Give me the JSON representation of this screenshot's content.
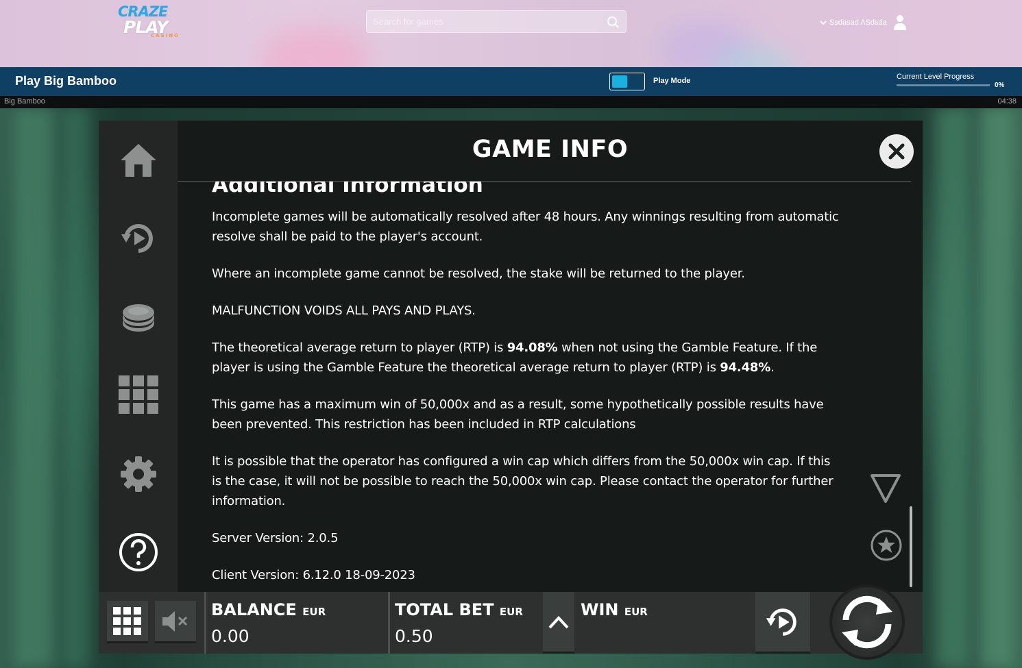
{
  "site": {
    "logo": {
      "line1": "CRAZE",
      "line2": "PLAY",
      "line3": "CASINO"
    },
    "search": {
      "placeholder": "Search for games"
    },
    "user": {
      "name": "Ssdasad ASdsda"
    }
  },
  "title_bar": {
    "title": "Play Big Bamboo",
    "play_mode_label": "Play Mode",
    "level_progress_label": "Current Level Progress",
    "level_progress_value": "0%",
    "level_progress_fraction": 0.0
  },
  "game_strip": {
    "game_name": "Big Bamboo",
    "clock": "04:38"
  },
  "dialog": {
    "title": "GAME INFO",
    "section_heading": "Additional Information",
    "paragraphs": {
      "p1": "Incomplete games will be automatically resolved after 48 hours. Any winnings resulting from automatic resolve shall be paid to the player's account.",
      "p2": "Where an incomplete game cannot be resolved, the stake will be returned to the player.",
      "p3": "MALFUNCTION VOIDS ALL PAYS AND PLAYS.",
      "p4a": "The theoretical average return to player (RTP) is ",
      "p4b": "94.08%",
      "p4c": " when not using the Gamble Feature. If the player is using the Gamble Feature the theoretical average return to player (RTP) is ",
      "p4d": "94.48%",
      "p4e": ".",
      "p5": "This game has a maximum win of 50,000x and as a result, some hypothetically possible results have been prevented. This restriction has been included in RTP calculations",
      "p6": "It is possible that the operator has configured a win cap which differs from the 50,000x win cap. If this is the case, it will not be possible to reach the 50,000x win cap. Please contact the operator for further information.",
      "p7": "Server Version: 2.0.5",
      "p8": "Client Version: 6.12.0 18-09-2023"
    },
    "side_menu_icons": [
      "home-icon",
      "autoplay-icon",
      "coins-icon",
      "grid-icon",
      "gear-icon",
      "help-icon"
    ]
  },
  "control_bar": {
    "balance_label": "BALANCE",
    "balance_currency": "EUR",
    "balance_value": "0.00",
    "total_bet_label": "TOTAL BET",
    "total_bet_currency": "EUR",
    "total_bet_value": "0.50",
    "win_label": "WIN",
    "win_currency": "EUR"
  },
  "colors": {
    "title_bar": "#0f3f63",
    "toggle_accent": "#1ab0e0",
    "panel_bg": "#161a19",
    "logo_blue": "#29a8e8",
    "logo_orange": "#f29b2a"
  }
}
